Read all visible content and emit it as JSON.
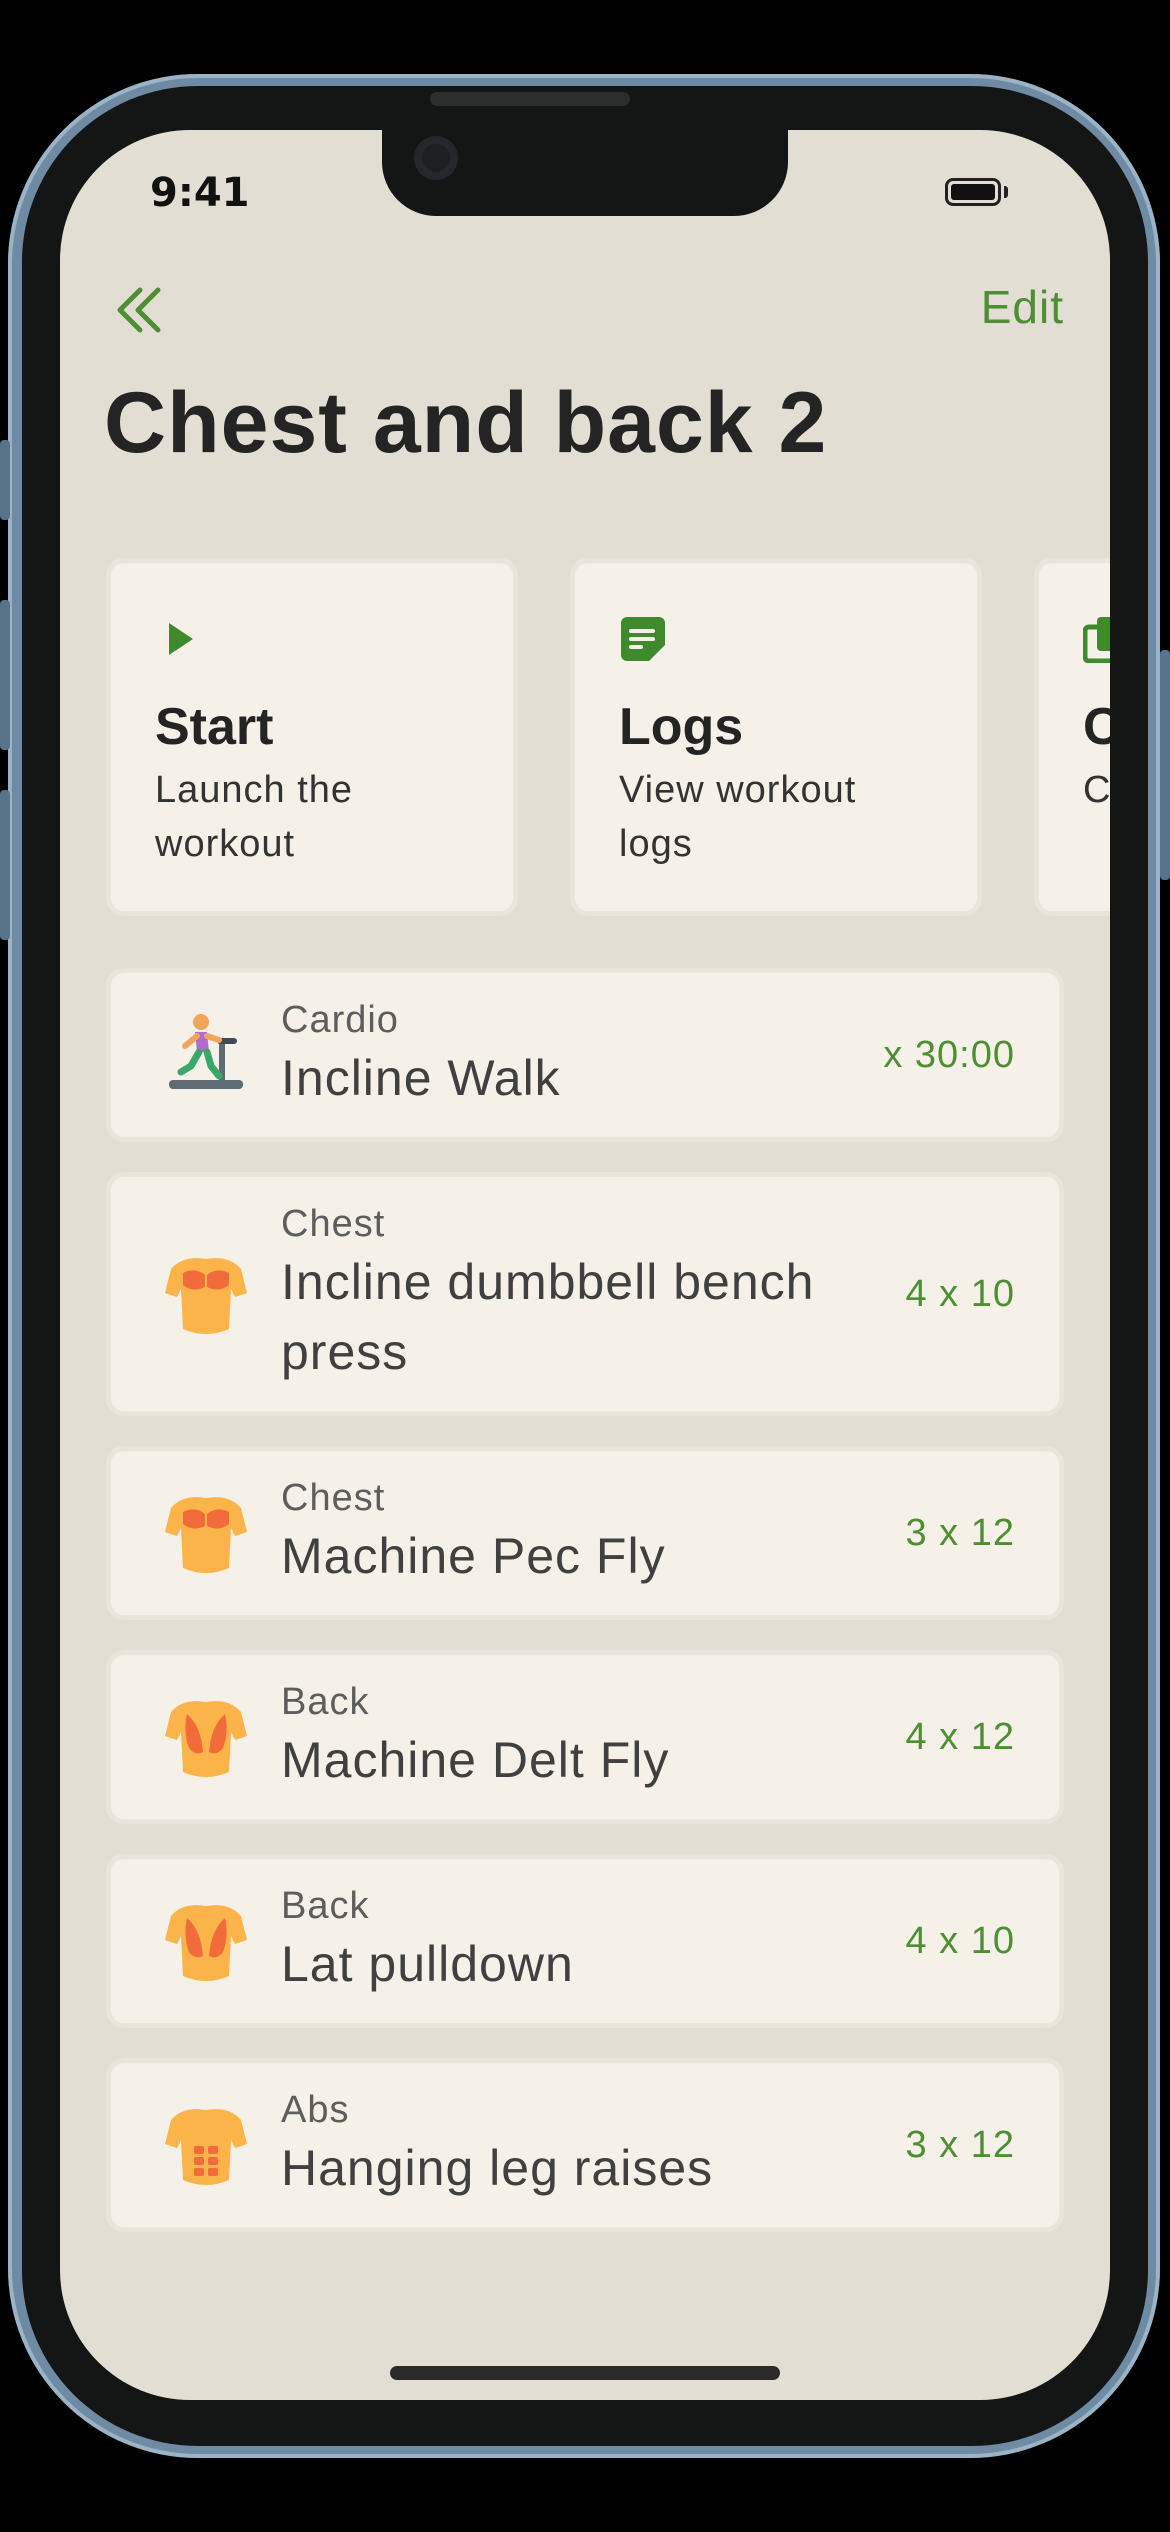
{
  "status_bar": {
    "time": "9:41"
  },
  "nav": {
    "back_icon": "double-chevron-left-icon",
    "edit_label": "Edit"
  },
  "page_title": "Chest and back 2",
  "colors": {
    "accent": "#4d8f32",
    "background": "#e2ded3",
    "card": "#f5f1e8"
  },
  "actions": [
    {
      "icon": "play-icon",
      "title": "Start",
      "description": "Launch the workout"
    },
    {
      "icon": "notes-icon",
      "title": "Logs",
      "description": "View workout logs"
    },
    {
      "icon": "copy-icon",
      "title": "C",
      "description": "C w"
    }
  ],
  "exercises": [
    {
      "icon": "treadmill-runner-icon",
      "category": "Cardio",
      "name": "Incline Walk",
      "sets": "x 30:00"
    },
    {
      "icon": "chest-muscle-icon",
      "category": "Chest",
      "name": "Incline dumbbell bench press",
      "sets": "4 x 10"
    },
    {
      "icon": "chest-muscle-icon",
      "category": "Chest",
      "name": "Machine Pec Fly",
      "sets": "3 x 12"
    },
    {
      "icon": "back-muscle-icon",
      "category": "Back",
      "name": "Machine Delt Fly",
      "sets": "4 x 12"
    },
    {
      "icon": "back-muscle-icon",
      "category": "Back",
      "name": "Lat pulldown",
      "sets": "4 x 10"
    },
    {
      "icon": "abs-muscle-icon",
      "category": "Abs",
      "name": "Hanging leg raises",
      "sets": "3 x 12"
    }
  ]
}
